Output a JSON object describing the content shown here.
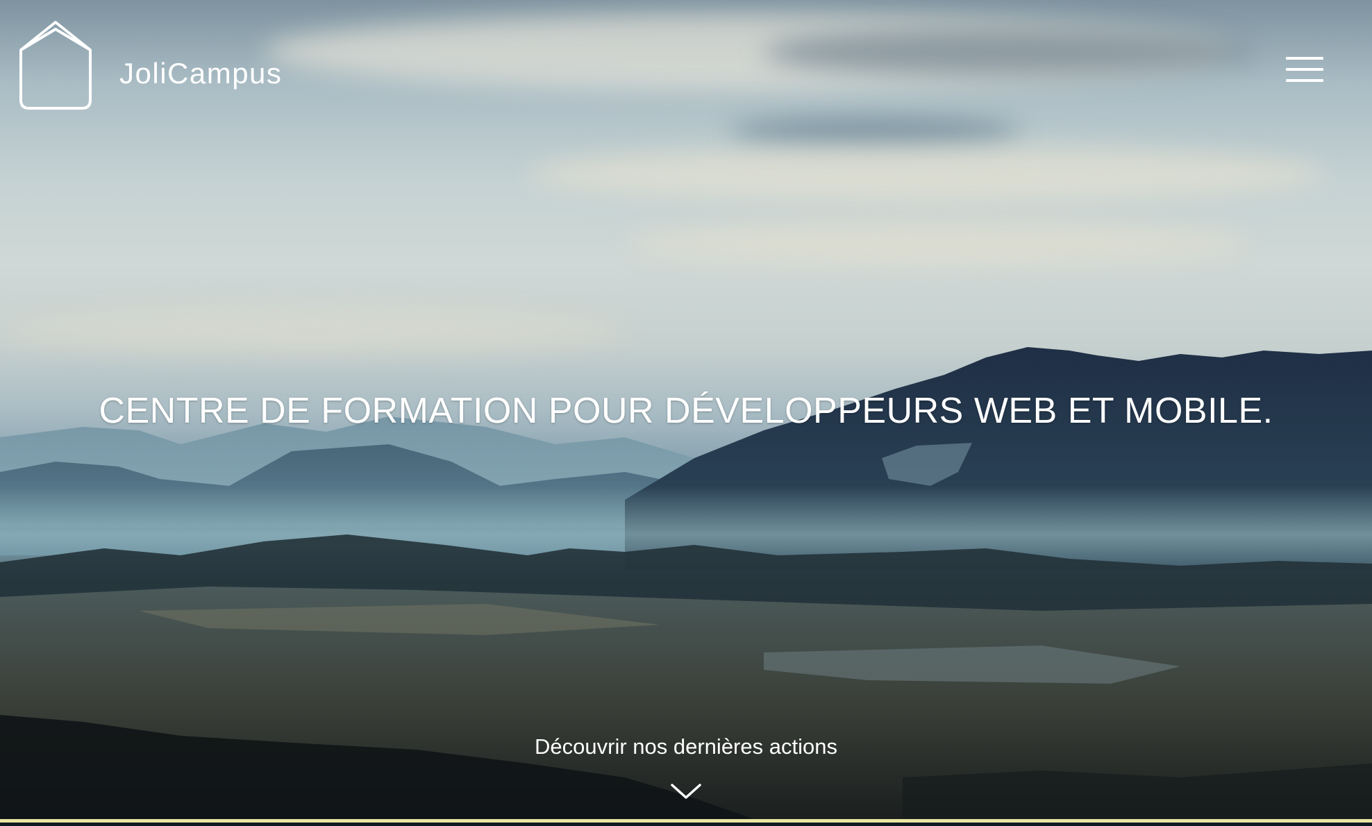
{
  "header": {
    "brand": "JoliCampus",
    "logo_icon": "house-outline-icon",
    "menu_icon": "hamburger-menu-icon"
  },
  "hero": {
    "headline": "CENTRE DE FORMATION POUR DÉVELOPPEURS WEB ET MOBILE.",
    "discover_label": "Découvrir nos dernières actions",
    "discover_icon": "chevron-down-icon"
  },
  "colors": {
    "text": "#ffffff",
    "accent_line": "#e9e7a2"
  }
}
